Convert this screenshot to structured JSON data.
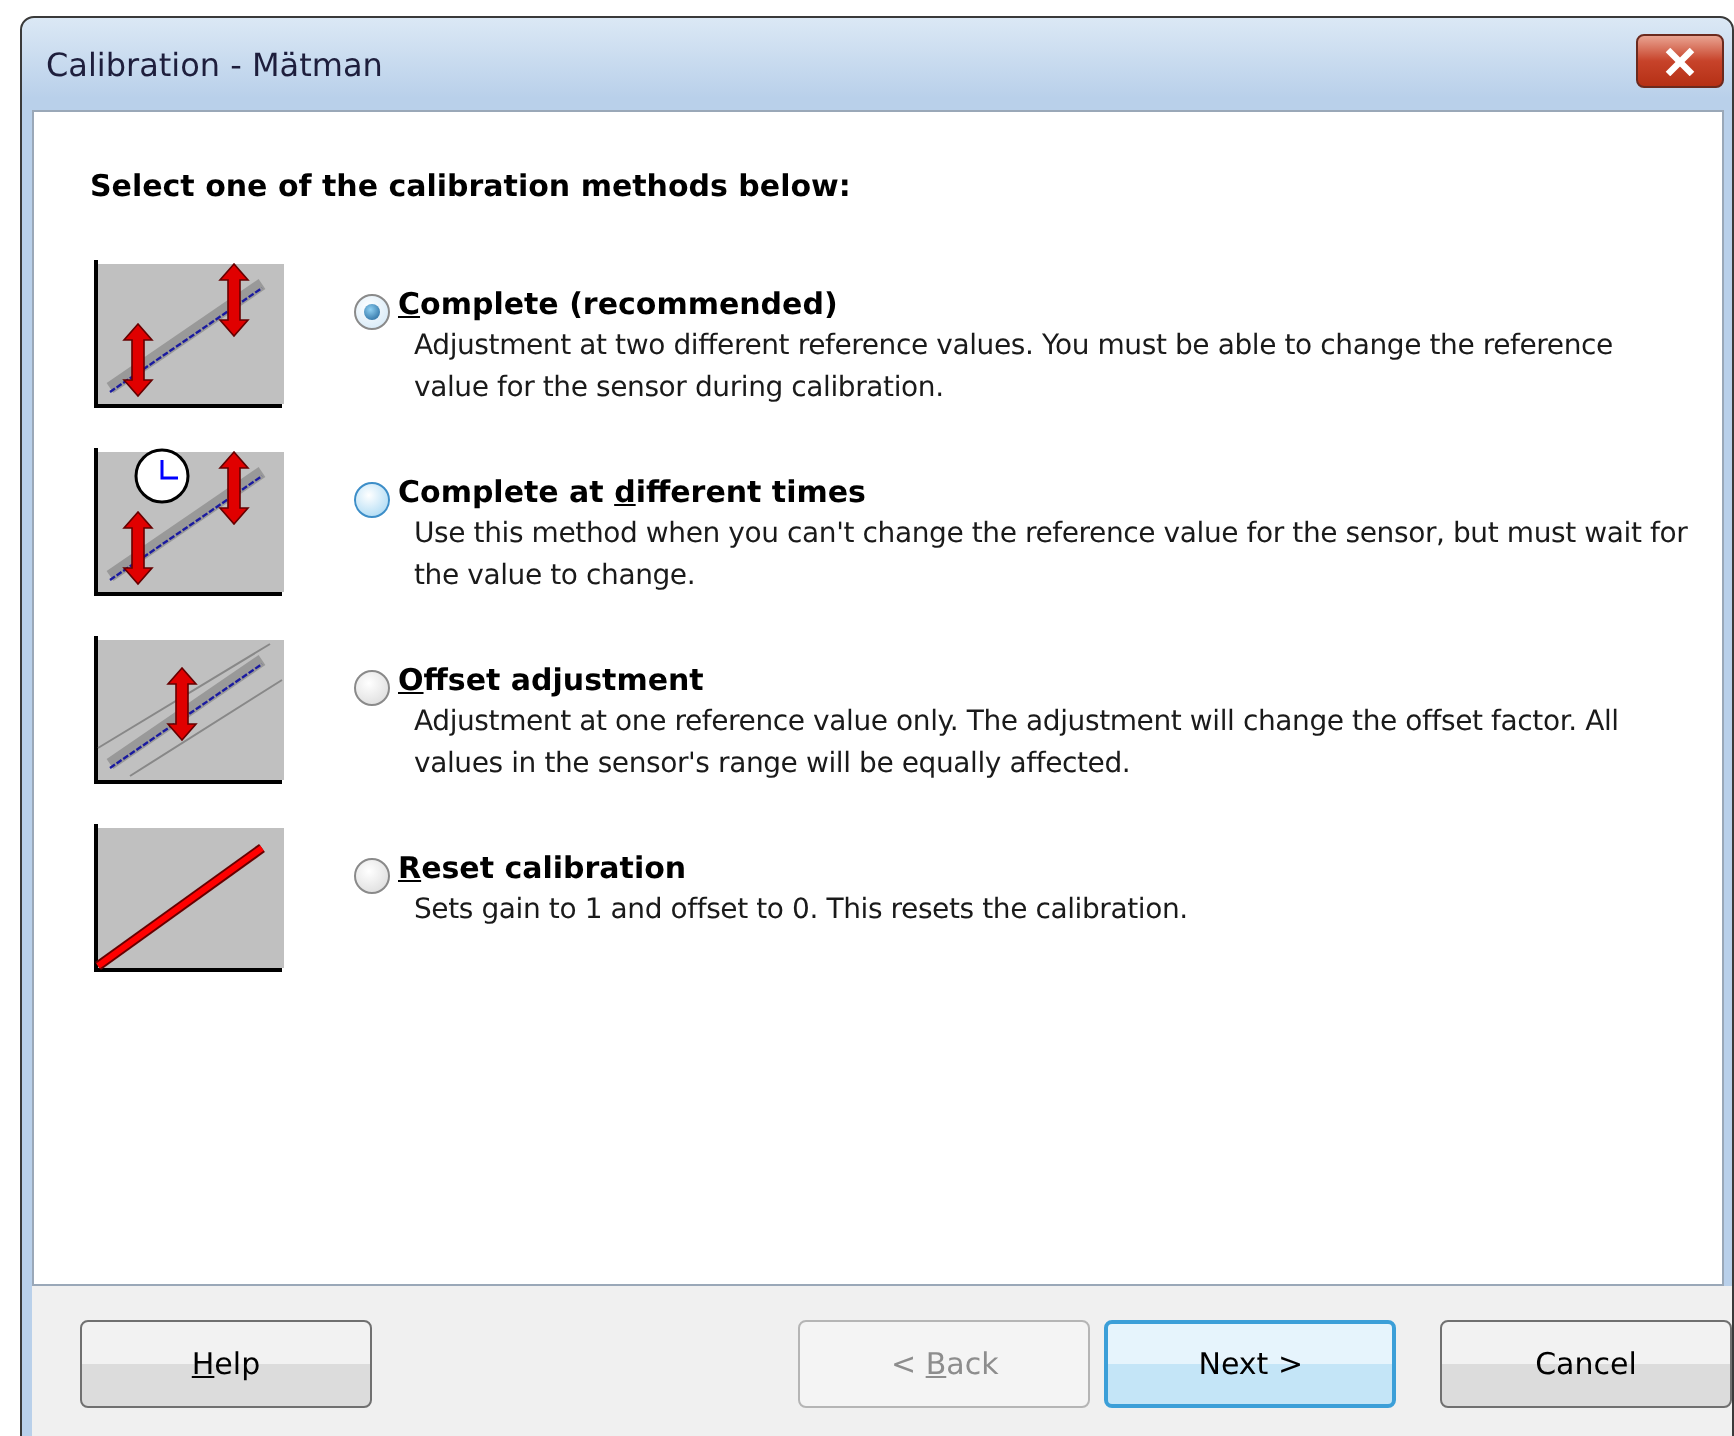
{
  "window": {
    "title": "Calibration - Mätman"
  },
  "instruction": "Select one of the calibration methods below:",
  "methods": [
    {
      "kind": "complete",
      "label": [
        {
          "text": "C",
          "underlined": true
        },
        {
          "text": "omplete (recommended)",
          "underlined": false
        }
      ],
      "description": "Adjustment at two different reference values. You must be able to change the reference value for the sensor during calibration.",
      "selected": true
    },
    {
      "kind": "timed",
      "label": [
        {
          "text": "Complete at ",
          "underlined": false
        },
        {
          "text": "d",
          "underlined": true
        },
        {
          "text": "ifferent times",
          "underlined": false
        }
      ],
      "description": "Use this method when you can't change the reference value for the sensor, but must wait for the value to change.",
      "selected": false
    },
    {
      "kind": "offset",
      "label": [
        {
          "text": "O",
          "underlined": true
        },
        {
          "text": "ffset adjustment",
          "underlined": false
        }
      ],
      "description": "Adjustment at one reference value only. The adjustment will change the offset factor. All values in the sensor's range will be equally affected.",
      "selected": false
    },
    {
      "kind": "reset",
      "label": [
        {
          "text": "R",
          "underlined": true
        },
        {
          "text": "eset calibration",
          "underlined": false
        }
      ],
      "description": "Sets gain to 1 and offset to 0. This resets the calibration.",
      "selected": false
    }
  ],
  "buttons": [
    {
      "label": [
        {
          "text": "H",
          "underlined": true
        },
        {
          "text": "elp",
          "underlined": false
        }
      ],
      "disabled": false,
      "default": false
    },
    {
      "label": [
        {
          "text": "< ",
          "underlined": false
        },
        {
          "text": "B",
          "underlined": true
        },
        {
          "text": "ack",
          "underlined": false
        }
      ],
      "disabled": true,
      "default": false
    },
    {
      "label": [
        {
          "text": "Next >",
          "underlined": false
        }
      ],
      "disabled": false,
      "default": true
    },
    {
      "label": [
        {
          "text": "Cancel",
          "underlined": false
        }
      ],
      "disabled": false,
      "default": false
    }
  ]
}
